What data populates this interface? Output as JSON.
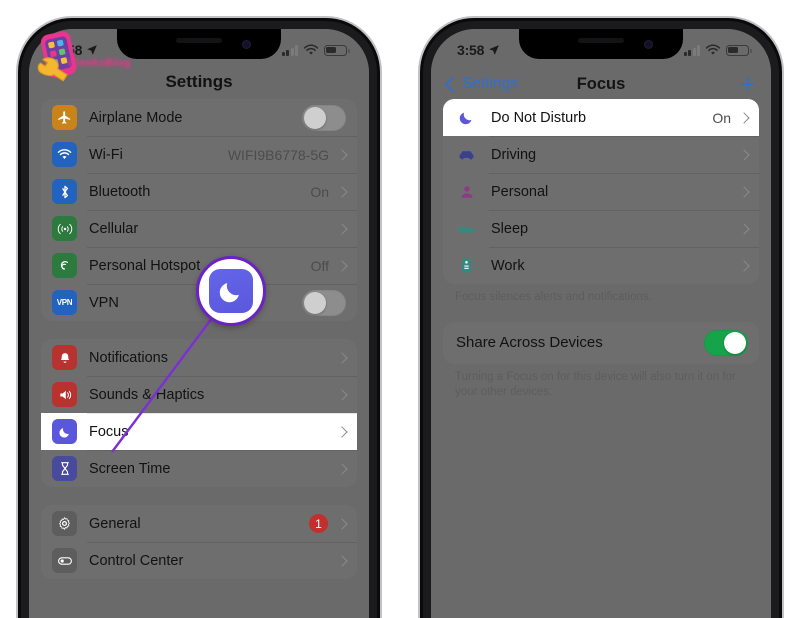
{
  "watermark": {
    "brand": "iGeeksBlog"
  },
  "left_phone": {
    "status_bar": {
      "time": "3:58",
      "location_icon": "location-arrow-icon",
      "signal_icon": "cellular-bars-icon",
      "wifi_icon": "wifi-icon",
      "battery_icon": "battery-icon"
    },
    "nav": {
      "title": "Settings"
    },
    "groups": [
      {
        "rows": [
          {
            "label": "Airplane Mode",
            "icon": "airplane-icon",
            "icon_color": "#c8841a",
            "control": "toggle",
            "toggle_on": false
          },
          {
            "label": "Wi-Fi",
            "icon": "wifi-icon",
            "icon_color": "#2363c0",
            "value": "WIFI9B6778-5G",
            "control": "chevron"
          },
          {
            "label": "Bluetooth",
            "icon": "bluetooth-icon",
            "icon_color": "#2363c0",
            "value": "On",
            "control": "chevron"
          },
          {
            "label": "Cellular",
            "icon": "cellular-antenna-icon",
            "icon_color": "#2d7a3e",
            "value": "",
            "control": "chevron"
          },
          {
            "label": "Personal Hotspot",
            "icon": "hotspot-icon",
            "icon_color": "#2d7a3e",
            "value": "Off",
            "control": "chevron"
          },
          {
            "label": "VPN",
            "icon": "vpn-icon",
            "icon_color": "#2363c0",
            "control": "toggle",
            "toggle_on": false
          }
        ]
      },
      {
        "rows": [
          {
            "label": "Notifications",
            "icon": "bell-icon",
            "icon_color": "#b8332f",
            "control": "chevron"
          },
          {
            "label": "Sounds & Haptics",
            "icon": "speaker-icon",
            "icon_color": "#b8332f",
            "control": "chevron"
          },
          {
            "label": "Focus",
            "icon": "moon-icon",
            "icon_color": "#5b57dd",
            "control": "chevron",
            "highlighted": true
          },
          {
            "label": "Screen Time",
            "icon": "hourglass-icon",
            "icon_color": "#484a9c",
            "control": "chevron"
          }
        ]
      },
      {
        "rows": [
          {
            "label": "General",
            "icon": "gear-icon",
            "icon_color": "#5d5d5d",
            "badge": "1",
            "control": "chevron"
          },
          {
            "label": "Control Center",
            "icon": "control-center-icon",
            "icon_color": "#5d5d5d",
            "control": "chevron"
          }
        ]
      }
    ]
  },
  "right_phone": {
    "status_bar": {
      "time": "3:58",
      "location_icon": "location-arrow-icon",
      "signal_icon": "cellular-bars-icon",
      "wifi_icon": "wifi-icon",
      "battery_icon": "battery-icon"
    },
    "nav": {
      "back_label": "Settings",
      "title": "Focus",
      "add_label": "+"
    },
    "focus_rows": [
      {
        "label": "Do Not Disturb",
        "icon": "moon-icon",
        "icon_color": "#5b57dd",
        "value": "On",
        "highlighted": true
      },
      {
        "label": "Driving",
        "icon": "car-icon",
        "icon_color": "#3b3f8c",
        "value": ""
      },
      {
        "label": "Personal",
        "icon": "person-icon",
        "icon_color": "#8e3a84",
        "value": ""
      },
      {
        "label": "Sleep",
        "icon": "bed-icon",
        "icon_color": "#2e8c82",
        "value": ""
      },
      {
        "label": "Work",
        "icon": "briefcase-icon",
        "icon_color": "#2e8c82",
        "value": ""
      }
    ],
    "focus_footnote": "Focus silences alerts and notifications.",
    "share_row": {
      "label": "Share Across Devices",
      "toggle_on": true,
      "toggle_color": "#16a34a"
    },
    "share_footnote": "Turning a Focus on for this device will also turn it on for your other devices."
  },
  "callout": {
    "icon": "moon-icon",
    "ring_color": "#6b21c8",
    "app_color": "#5b57dd",
    "line_color": "#7b2fd4"
  }
}
